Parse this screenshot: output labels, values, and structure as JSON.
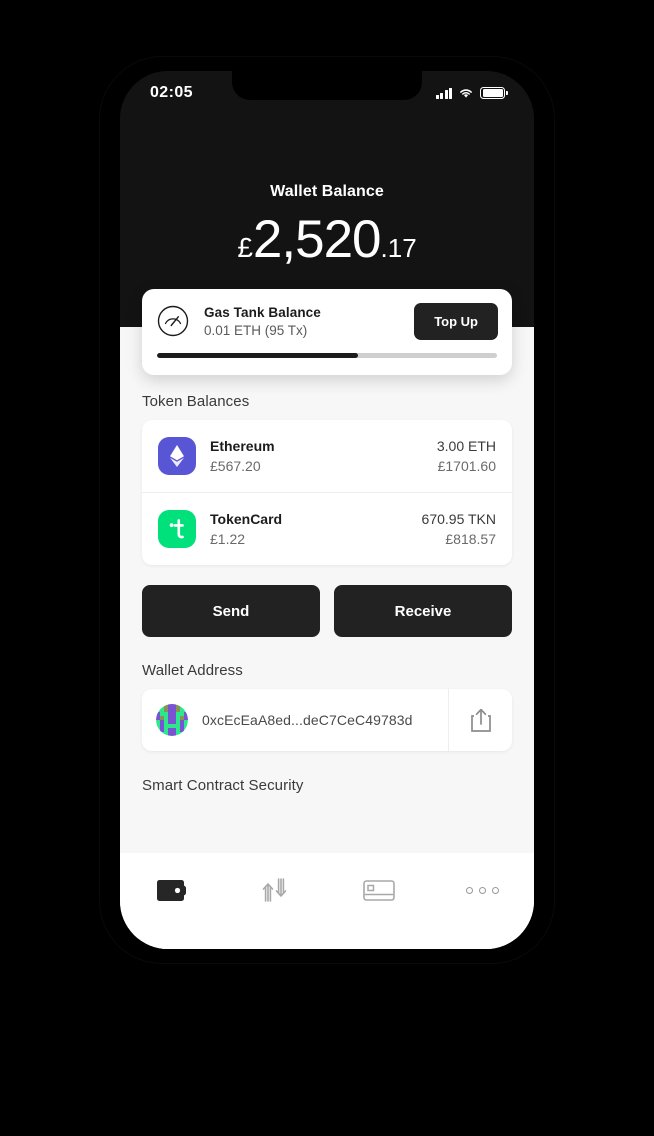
{
  "status_bar": {
    "time": "02:05",
    "signal_icon": "signal-bars-icon",
    "wifi_icon": "wifi-icon",
    "battery_icon": "battery-icon"
  },
  "header": {
    "title": "Wallet Balance",
    "currency_symbol": "£",
    "amount_whole": "2,520",
    "amount_decimal": ".17",
    "background_color": "#131313"
  },
  "gas_tank": {
    "icon": "gauge-icon",
    "title": "Gas Tank Balance",
    "subtitle": "0.01 ETH (95 Tx)",
    "button_label": "Top Up",
    "progress_percent": 59,
    "progress_fill_color": "#1c1c1c",
    "progress_track_color": "#cfcfcf"
  },
  "token_balances": {
    "section_title": "Token Balances",
    "tokens": [
      {
        "icon": "ethereum-icon",
        "icon_color": "#5956d6",
        "name": "Ethereum",
        "price": "£567.20",
        "amount": "3.00 ETH",
        "value": "£1701.60"
      },
      {
        "icon": "tokencard-icon",
        "icon_color": "#00e07b",
        "name": "TokenCard",
        "price": "£1.22",
        "amount": "670.95 TKN",
        "value": "£818.57"
      }
    ]
  },
  "actions": {
    "send_label": "Send",
    "receive_label": "Receive",
    "button_color": "#222222"
  },
  "wallet_address": {
    "section_title": "Wallet Address",
    "avatar": "blockie-avatar",
    "address": "0xcEcEaA8ed...deC7CeC49783d",
    "share_icon": "share-icon"
  },
  "smart_contract": {
    "section_title": "Smart Contract Security"
  },
  "tab_bar": {
    "tabs": [
      {
        "icon": "wallet-icon",
        "active": true
      },
      {
        "icon": "transfer-arrows-icon",
        "active": false
      },
      {
        "icon": "card-icon",
        "active": false
      },
      {
        "icon": "more-dots-icon",
        "active": false
      }
    ]
  }
}
